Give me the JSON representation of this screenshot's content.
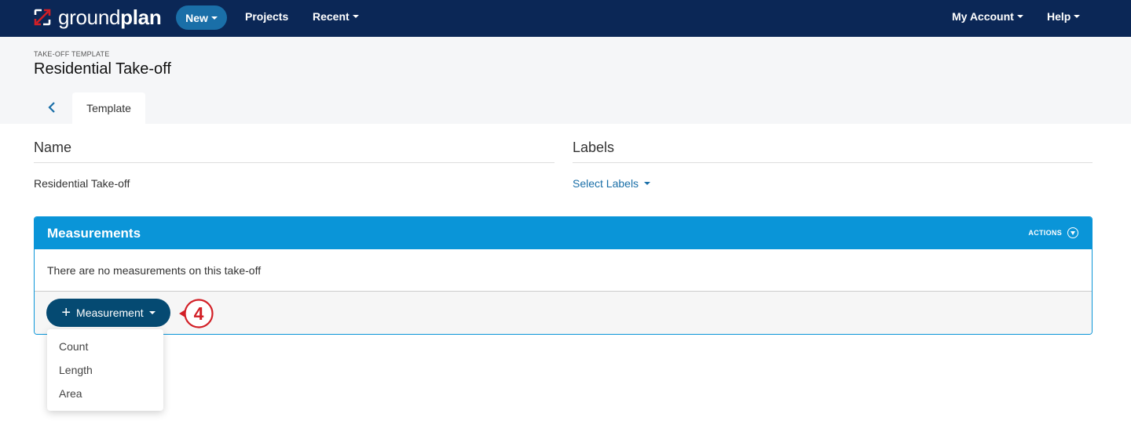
{
  "navbar": {
    "logo": {
      "light": "ground",
      "bold": "plan",
      "icon": "groundplan-logo-icon"
    },
    "new_label": "New",
    "projects_label": "Projects",
    "recent_label": "Recent",
    "account_label": "My Account",
    "help_label": "Help"
  },
  "header": {
    "eyebrow": "TAKE-OFF TEMPLATE",
    "title": "Residential Take-off",
    "back_icon": "chevron-left-icon",
    "tabs": [
      {
        "label": "Template",
        "active": true
      }
    ]
  },
  "fields": {
    "name": {
      "label": "Name",
      "value": "Residential Take-off"
    },
    "labels": {
      "label": "Labels",
      "select_label": "Select Labels"
    }
  },
  "panel": {
    "title": "Measurements",
    "actions_label": "ACTIONS",
    "empty_message": "There are no measurements on this take-off",
    "add_button_label": "Measurement",
    "dropdown_items": [
      "Count",
      "Length",
      "Area"
    ]
  },
  "callout": {
    "number": "4",
    "color": "#d21f26"
  },
  "colors": {
    "navbar": "#0b2756",
    "accent": "#0a95d8",
    "button_dark": "#054a72",
    "link": "#1a6fa8"
  }
}
